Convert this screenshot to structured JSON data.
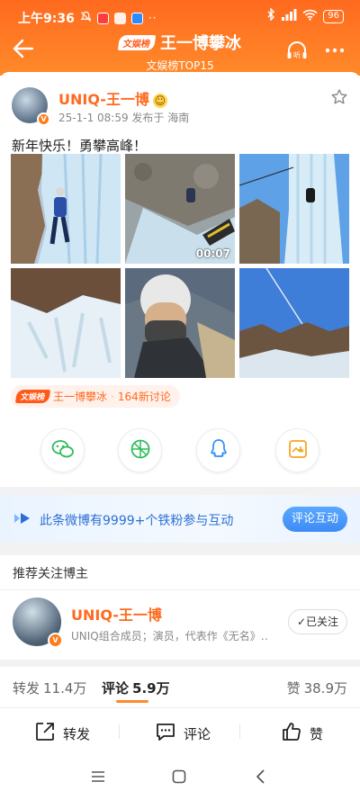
{
  "status_bar": {
    "time": "上午9:36",
    "dots": "··",
    "battery": "96"
  },
  "nav": {
    "tag": "文娱榜",
    "title": "王一博攀冰",
    "subtitle": "文娱榜TOP15",
    "listen_label": "听"
  },
  "post": {
    "author": "UNIQ-王一博",
    "meta": "25-1-1 08:59  发布于 海南",
    "text": "新年快乐！勇攀高峰！",
    "video_duration": "00:07",
    "topic": {
      "tag": "文娱榜",
      "name": "王一博攀冰",
      "separator": "·",
      "count": "164新讨论"
    }
  },
  "banner": {
    "text": "此条微博有9999+个铁粉参与互动",
    "button": "评论互动"
  },
  "recommend": {
    "title": "推荐关注博主",
    "name": "UNIQ-王一博",
    "desc": "UNIQ组合成员；演员，代表作《无名》…",
    "follow_label": "已关注"
  },
  "tabs": {
    "repost_label": "转发",
    "repost_count": "11.4万",
    "comment_label": "评论",
    "comment_count": "5.9万",
    "like_label": "赞",
    "like_count": "38.9万"
  },
  "actions": {
    "repost": "转发",
    "comment": "评论",
    "like": "赞"
  },
  "colors": {
    "brand_orange": "#ff6a1f",
    "link_blue": "#2b6fd6"
  }
}
